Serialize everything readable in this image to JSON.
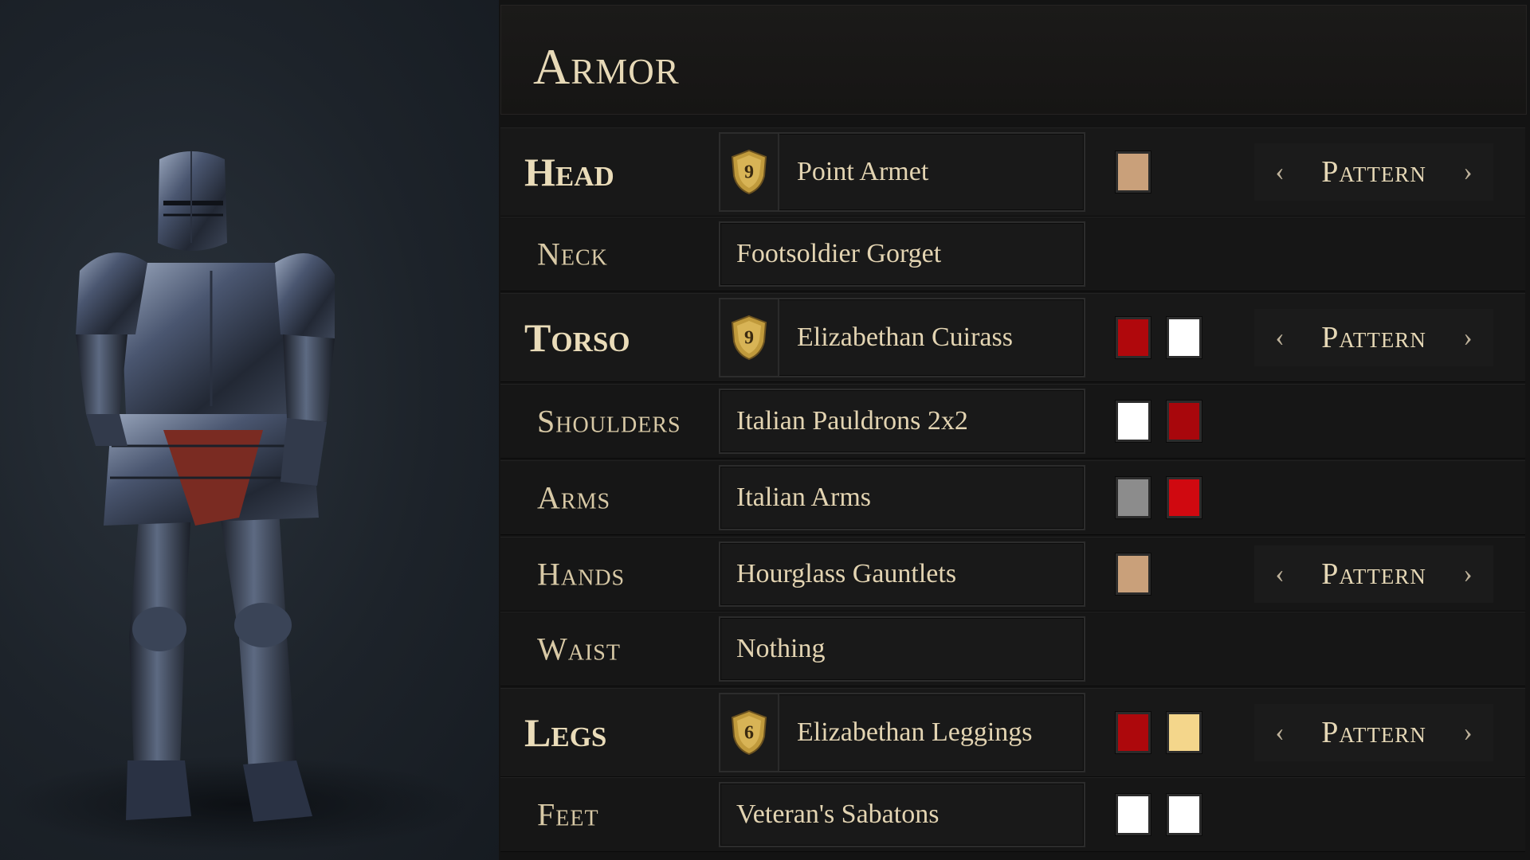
{
  "panel": {
    "title": "Armor"
  },
  "slots": [
    {
      "slot": "Head",
      "item": "Point Armet",
      "crest": "9",
      "colors": [
        "#c9a07a"
      ],
      "pattern": "Pattern"
    },
    {
      "slot": "Neck",
      "item": "Footsoldier Gorget",
      "crest": null,
      "colors": [],
      "pattern": null
    },
    {
      "slot": "Torso",
      "item": "Elizabethan Cuirass",
      "crest": "9",
      "colors": [
        "#b0080c",
        "#ffffff"
      ],
      "pattern": "Pattern"
    },
    {
      "slot": "Shoulders",
      "item": "Italian Pauldrons 2x2",
      "crest": null,
      "colors": [
        "#ffffff",
        "#a8070c"
      ],
      "pattern": null
    },
    {
      "slot": "Arms",
      "item": "Italian Arms",
      "crest": null,
      "colors": [
        "#8c8c8c",
        "#d00910"
      ],
      "pattern": null
    },
    {
      "slot": "Hands",
      "item": "Hourglass Gauntlets",
      "crest": null,
      "colors": [
        "#c9a07a"
      ],
      "pattern": "Pattern"
    },
    {
      "slot": "Waist",
      "item": "Nothing",
      "crest": null,
      "colors": [],
      "pattern": null
    },
    {
      "slot": "Legs",
      "item": "Elizabethan Leggings",
      "crest": "6",
      "colors": [
        "#ad080c",
        "#f4d68b"
      ],
      "pattern": "Pattern"
    },
    {
      "slot": "Feet",
      "item": "Veteran's Sabatons",
      "crest": null,
      "colors": [
        "#ffffff",
        "#ffffff"
      ],
      "pattern": null
    }
  ],
  "icons": {
    "prev": "chevron-left-icon",
    "next": "chevron-right-icon",
    "crest": "shield-crest-icon"
  }
}
